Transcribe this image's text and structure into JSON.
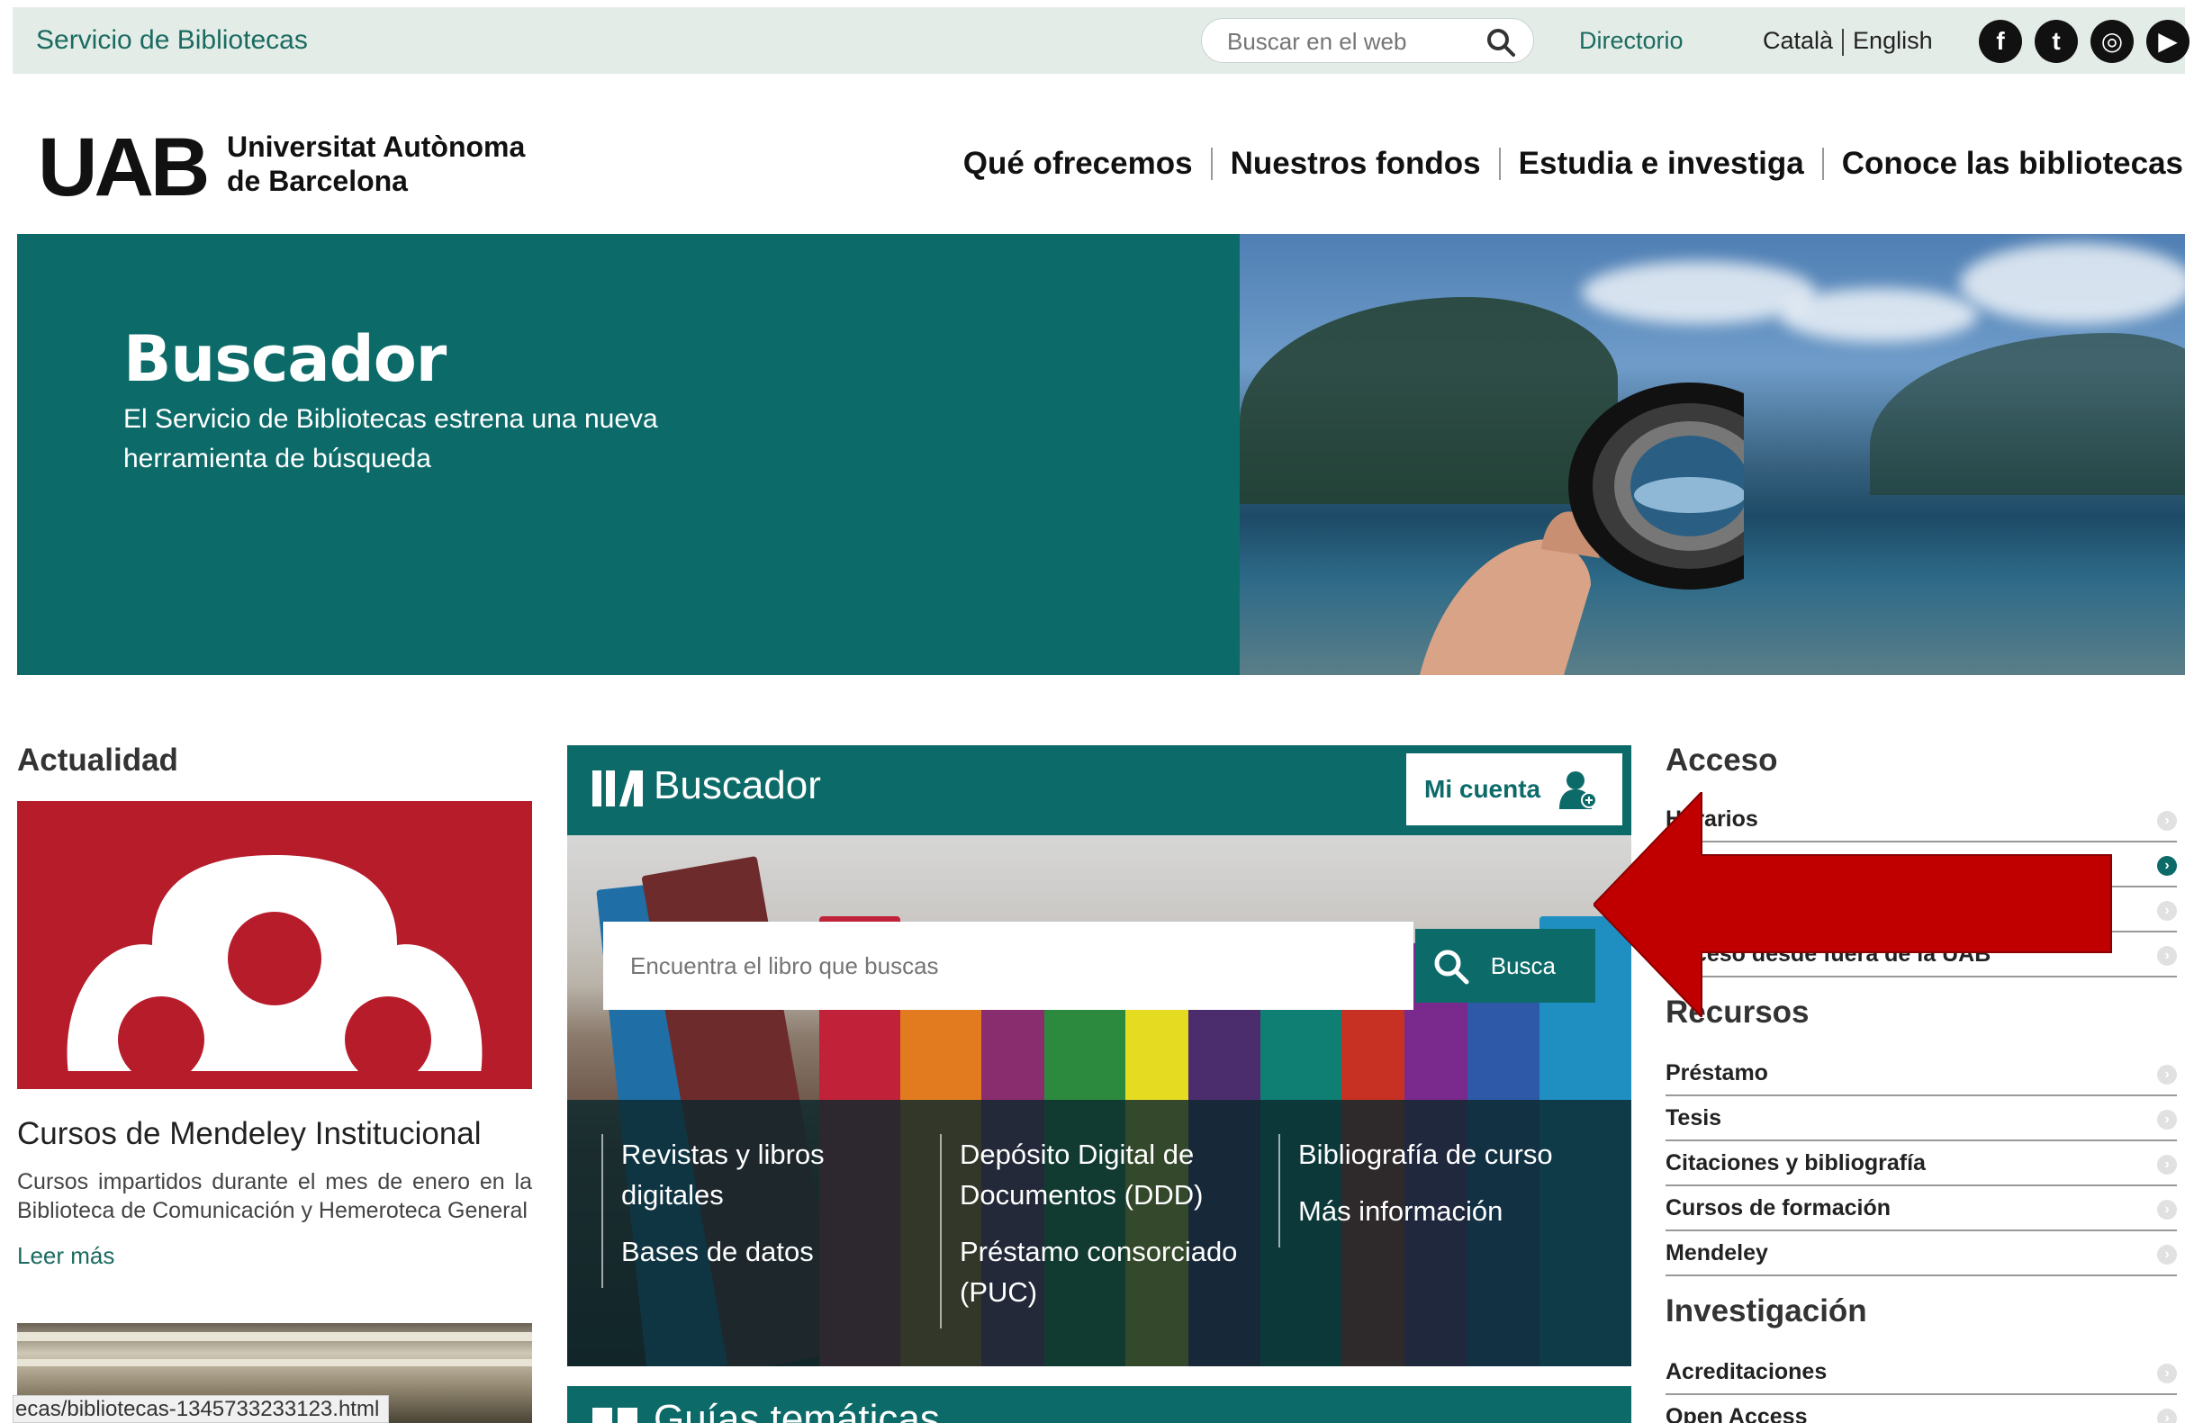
{
  "topbar": {
    "site_name": "Servicio de Bibliotecas",
    "search_placeholder": "Buscar en el web",
    "directorio": "Directorio",
    "lang_catala": "Català",
    "lang_english": "English",
    "social": [
      {
        "icon": "facebook-icon",
        "glyph": "f"
      },
      {
        "icon": "twitter-icon",
        "glyph": "t"
      },
      {
        "icon": "instagram-icon",
        "glyph": "◎"
      },
      {
        "icon": "youtube-icon",
        "glyph": "▶"
      }
    ]
  },
  "header": {
    "logo_mark": "UAB",
    "univ_line1": "Universitat Autònoma",
    "univ_line2": "de Barcelona",
    "nav": [
      "Qué ofrecemos",
      "Nuestros fondos",
      "Estudia e investiga",
      "Conoce las bibliotecas"
    ]
  },
  "hero": {
    "title": "Buscador",
    "subtitle_line1": "El Servicio de Bibliotecas estrena una nueva",
    "subtitle_line2": "herramienta de búsqueda"
  },
  "actualidad": {
    "heading": "Actualidad",
    "news_title": "Cursos de Mendeley Institucional",
    "news_desc": "Cursos impartidos durante el mes de enero en la Biblioteca de Comunicación y Hemeroteca General",
    "read_more": "Leer más",
    "status_url": "ecas/bibliotecas-1345733233123.html"
  },
  "buscador": {
    "title": "Buscador",
    "mi_cuenta": "Mi cuenta",
    "input_placeholder": "Encuentra el libro que buscas",
    "search_button": "Busca",
    "col1": [
      "Revistas y libros digitales",
      "Bases de datos"
    ],
    "col2": [
      "Depósito Digital de Documentos (DDD)",
      "Préstamo consorciado (PUC)"
    ],
    "col3": [
      "Bibliografía de curso",
      "Más información"
    ],
    "next_section": "Guías temáticas"
  },
  "sidebar": {
    "acceso": {
      "heading": "Acceso",
      "items": [
        "Horarios",
        "",
        "",
        "Acceso desde fuera de la UAB"
      ]
    },
    "recursos": {
      "heading": "Recursos",
      "items": [
        "Préstamo",
        "Tesis",
        "Citaciones y bibliografía",
        "Cursos de formación",
        "Mendeley"
      ]
    },
    "investigacion": {
      "heading": "Investigación",
      "items": [
        "Acreditaciones",
        "Open Access"
      ]
    }
  },
  "colors": {
    "brand_teal": "#0c6b69",
    "annotation_red": "#c00000"
  }
}
